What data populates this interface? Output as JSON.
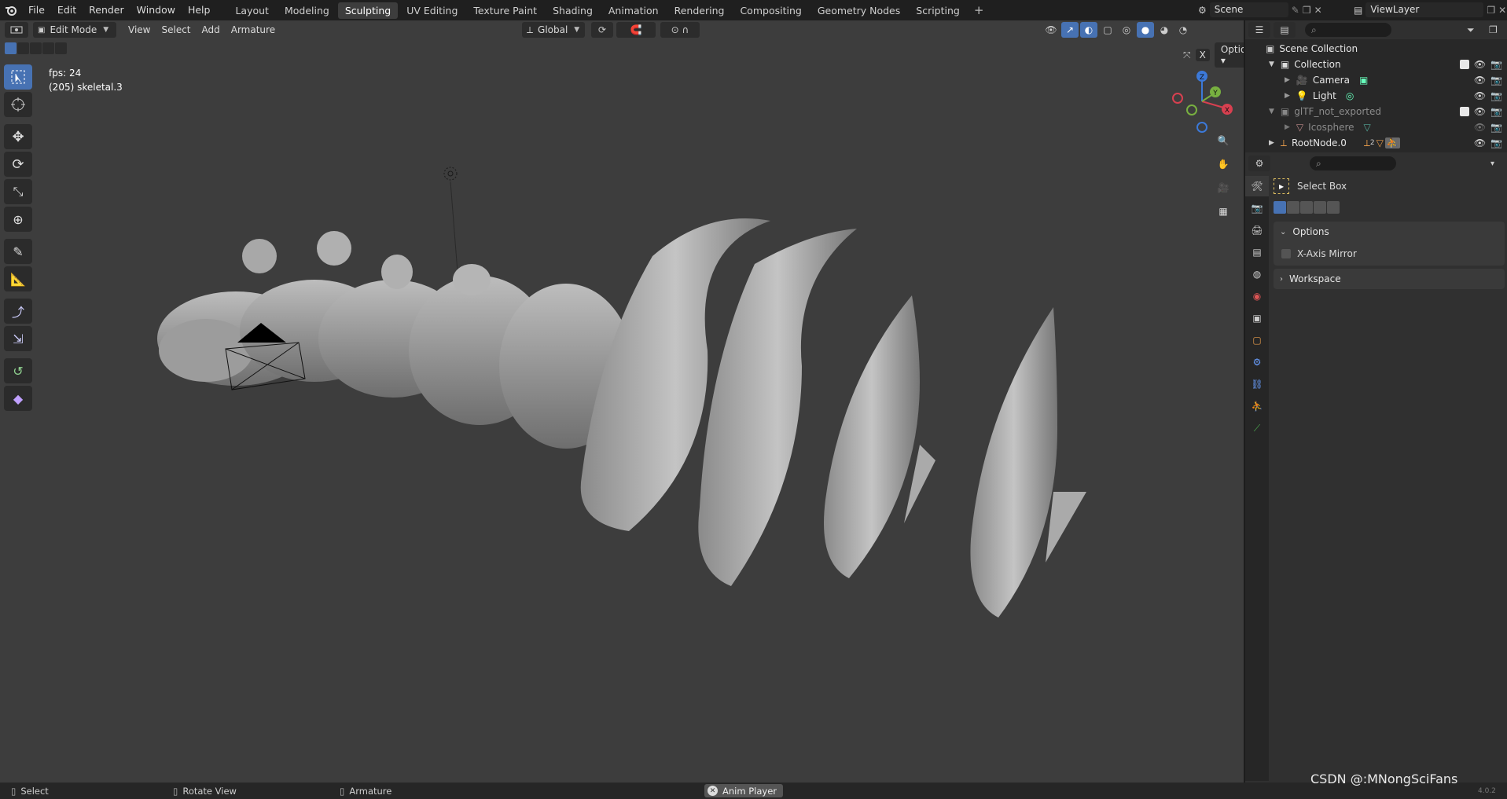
{
  "app": {
    "menus": [
      "File",
      "Edit",
      "Render",
      "Window",
      "Help"
    ],
    "workspaces": [
      "Layout",
      "Modeling",
      "Sculpting",
      "UV Editing",
      "Texture Paint",
      "Shading",
      "Animation",
      "Rendering",
      "Compositing",
      "Geometry Nodes",
      "Scripting"
    ],
    "active_workspace": "Sculpting",
    "scene_name": "Scene",
    "view_layer": "ViewLayer"
  },
  "viewport": {
    "mode": "Edit Mode",
    "menus": [
      "View",
      "Select",
      "Add",
      "Armature"
    ],
    "transform_orientation": "Global",
    "overlay": {
      "fps": "fps: 24",
      "object": "(205) skeletal.3"
    },
    "options_label": "Options",
    "gizmo_axes": {
      "x": "X",
      "y": "Y",
      "z": "Z"
    },
    "x_button": "X"
  },
  "outliner": {
    "root": "Scene Collection",
    "rows": [
      {
        "name": "Collection",
        "indent": 1,
        "dim": false
      },
      {
        "name": "Camera",
        "indent": 2,
        "dim": false
      },
      {
        "name": "Light",
        "indent": 2,
        "dim": false
      },
      {
        "name": "glTF_not_exported",
        "indent": 1,
        "dim": true
      },
      {
        "name": "Icosphere",
        "indent": 2,
        "dim": true
      },
      {
        "name": "RootNode.0",
        "indent": 1,
        "dim": false
      }
    ],
    "rootnode_badge": "2"
  },
  "properties": {
    "tool_name": "Select Box",
    "panels": [
      {
        "title": "Options",
        "expanded": true,
        "options": [
          "X-Axis Mirror"
        ]
      },
      {
        "title": "Workspace",
        "expanded": false,
        "options": []
      }
    ]
  },
  "status": {
    "items": [
      "Select",
      "Rotate View",
      "Armature"
    ],
    "anim_player": "Anim Player",
    "version": "4.0.2"
  },
  "watermark": "CSDN @:MNongSciFans",
  "colors": {
    "accent": "#4772b3",
    "viewport": "#3d3d3d",
    "panel": "#303030"
  }
}
